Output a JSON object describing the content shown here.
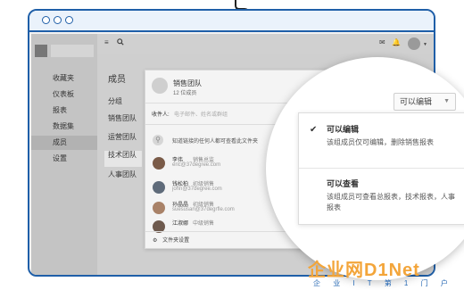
{
  "sidebar": {
    "items": [
      {
        "label": "收藏夹"
      },
      {
        "label": "仪表板"
      },
      {
        "label": "报表"
      },
      {
        "label": "数据集"
      },
      {
        "label": "成员"
      },
      {
        "label": "设置"
      }
    ]
  },
  "main": {
    "title": "成员",
    "subnav": [
      {
        "label": "分组"
      },
      {
        "label": "销售团队"
      },
      {
        "label": "运营团队"
      },
      {
        "label": "技术团队"
      },
      {
        "label": "人事团队"
      }
    ]
  },
  "panel": {
    "team_name": "销售团队",
    "team_count": "12 位成员",
    "recipient_label": "收件人:",
    "recipient_placeholder": "电子邮件、姓名或群组",
    "link_text": "知道链接的任何人都可查看此文件夹",
    "members": [
      {
        "name": "李伟",
        "role": "销售总监",
        "email": "eric@37degree.com"
      },
      {
        "name": "钱松柏",
        "role": "初级销售",
        "email": "john@37degree.com"
      },
      {
        "name": "孙晶晶",
        "role": "初级销售",
        "email": "suesusan@37degrfle.com"
      },
      {
        "name": "江淑娜",
        "role": "中级销售",
        "email": ""
      }
    ],
    "folder_settings": "文件夹设置"
  },
  "permission": {
    "selected": "可以编辑",
    "options": [
      {
        "title": "可以编辑",
        "desc": "该组成员仅可编辑，删除销售报表",
        "checked": true
      },
      {
        "title": "可以查看",
        "desc": "该组成员可查看总报表，技术报表，人事报表",
        "checked": false
      }
    ]
  },
  "watermark": {
    "big": "企业网D1Net",
    "small": "企 业 I T 第 1 门 户"
  },
  "colors": {
    "frame": "#1f5fa8",
    "watermark_orange": "#f3a53a",
    "watermark_blue": "#2567b3"
  }
}
